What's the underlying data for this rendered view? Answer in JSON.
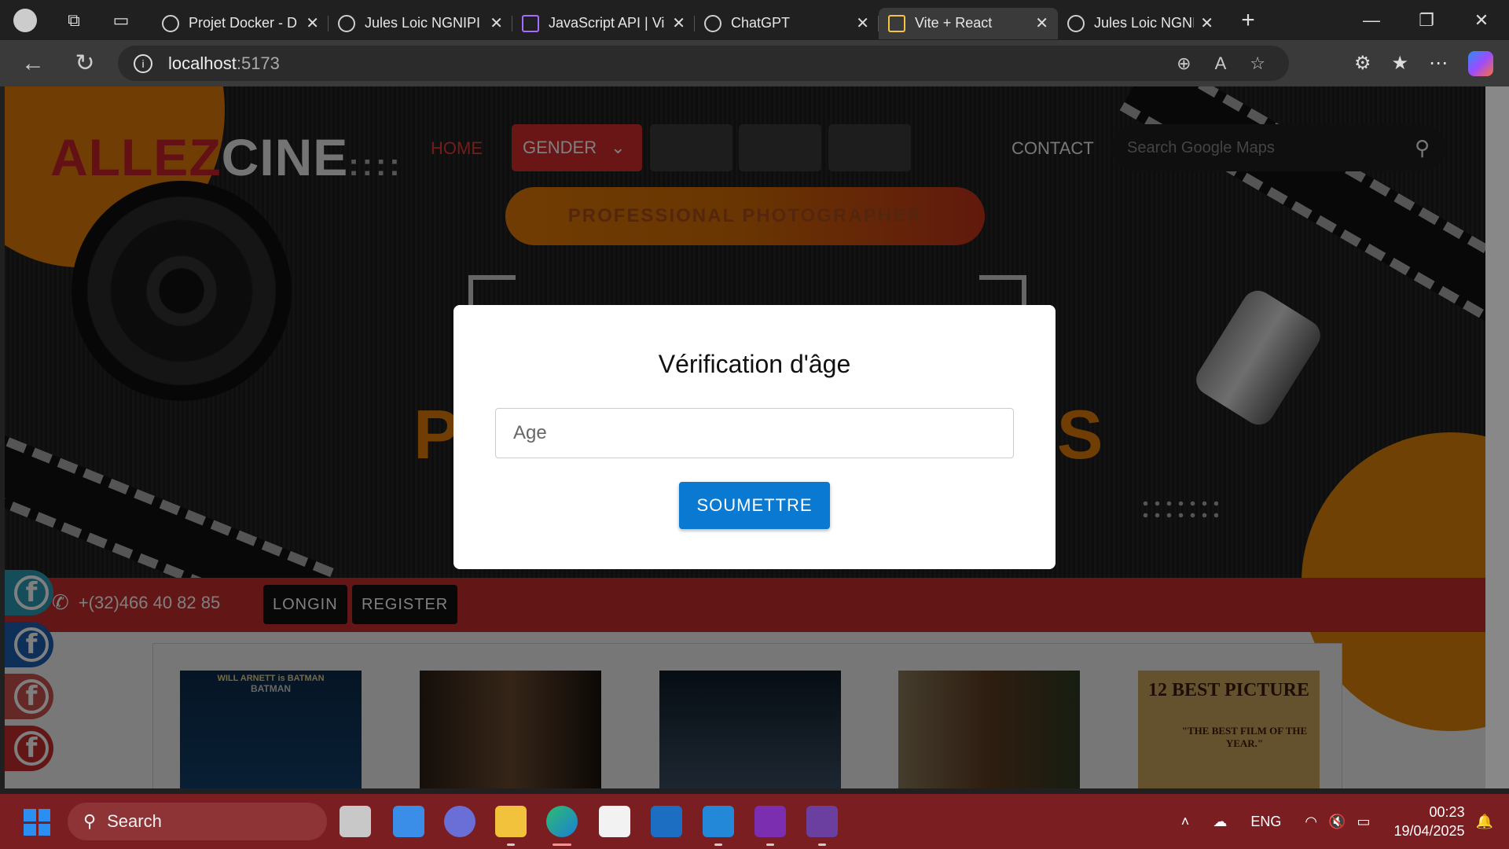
{
  "browser": {
    "tabs": [
      {
        "label": "Projet Docker - D"
      },
      {
        "label": "Jules Loic NGNIPI"
      },
      {
        "label": "JavaScript API | Vi"
      },
      {
        "label": "ChatGPT"
      },
      {
        "label": "Vite + React"
      },
      {
        "label": "Jules Loic NGNIPI"
      }
    ],
    "url": {
      "host": "localhost",
      "port": ":5173"
    }
  },
  "site": {
    "logo": {
      "part1": "ALLEZ",
      "part2": "CINE",
      "dots": "::::"
    },
    "nav": {
      "home": "HOME",
      "gender": "GENDER",
      "contact": "CONTACT"
    },
    "search": {
      "placeholder": "Search Google Maps"
    },
    "banner": "PROFESSIONAL PHOTOGRAPHER",
    "phone": "+(32)466 40 82 85",
    "login": "LONGIN",
    "register": "REGISTER",
    "posters": [
      {
        "title": "WILL ARNETT is BATMAN",
        "sub": "BATMAN"
      },
      {
        "title": ""
      },
      {
        "title": ""
      },
      {
        "title": ""
      },
      {
        "title": "12 BEST PICTURE",
        "sub": "\"THE BEST FILM OF THE YEAR.\""
      }
    ]
  },
  "modal": {
    "title": "Vérification d'âge",
    "age_placeholder": "Age",
    "submit": "SOUMETTRE"
  },
  "taskbar": {
    "search": "Search",
    "lang": "ENG",
    "time": "00:23",
    "date": "19/04/2025"
  },
  "colors": {
    "accent_red": "#c42c2c",
    "accent_orange": "#e07a0a",
    "submit_blue": "#0a79d1"
  }
}
